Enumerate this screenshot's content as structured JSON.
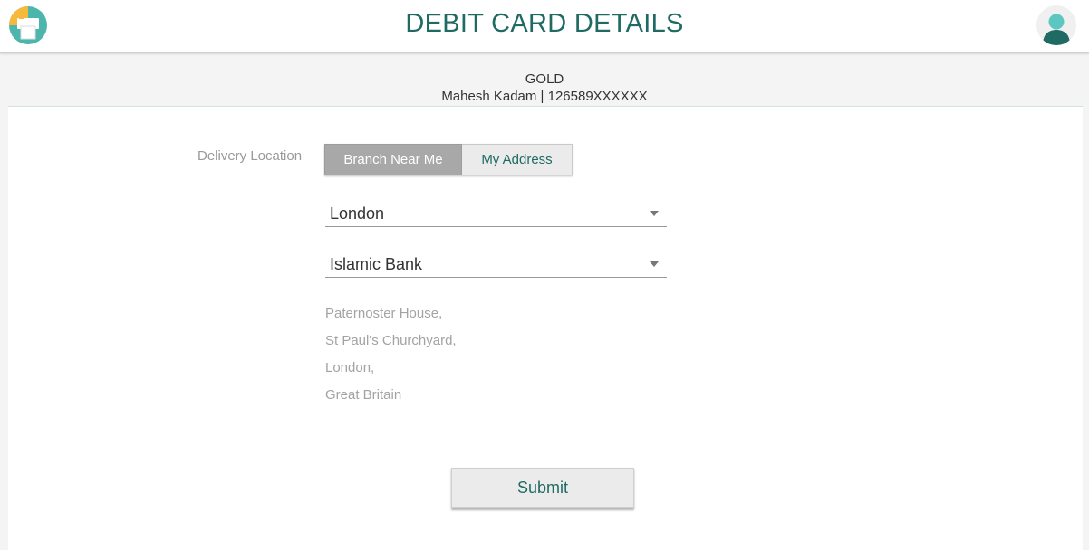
{
  "header": {
    "title": "DEBIT CARD DETAILS",
    "logo_icon": "printer-icon",
    "avatar_icon": "user-avatar-icon"
  },
  "card": {
    "type": "GOLD",
    "holder_line": "Mahesh Kadam | 126589XXXXXX"
  },
  "form": {
    "delivery_label": "Delivery Location",
    "toggle": {
      "options": [
        "Branch Near Me",
        "My Address"
      ],
      "selected": "Branch Near Me"
    },
    "city_select": {
      "value": "London",
      "icon": "caret-down-icon"
    },
    "branch_select": {
      "value": "Islamic Bank",
      "icon": "caret-down-icon"
    },
    "address_lines": [
      "Paternoster House,",
      "St Paul's Churchyard,",
      "London,",
      "Great Britain"
    ],
    "submit_label": "Submit"
  },
  "colors": {
    "accent": "#1f6b63",
    "avatar_head": "#5cc7c0",
    "avatar_body": "#1f6b63",
    "logo_teal": "#4db6ac",
    "logo_yellow": "#f6b93b"
  }
}
